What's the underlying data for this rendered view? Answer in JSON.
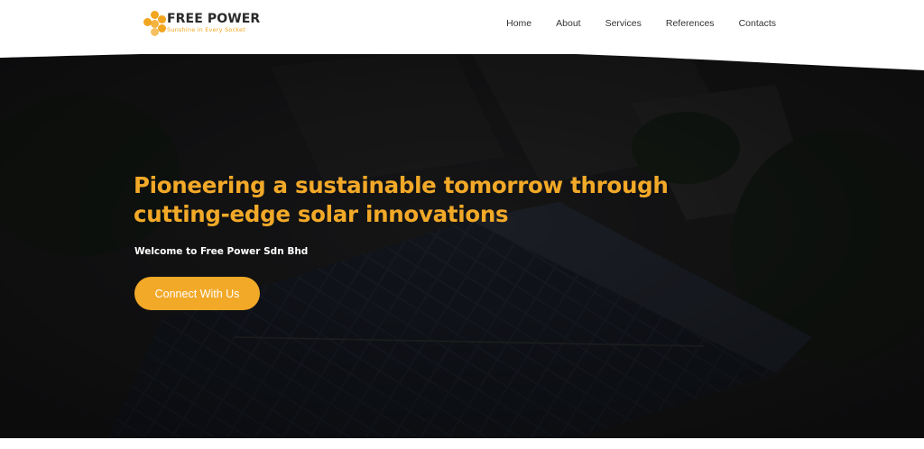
{
  "brand": {
    "name": "FREE POWER",
    "tagline": "Sunshine in Every Socket",
    "logo_icon": "honeycomb-dots-logo",
    "accent_color": "#f2a928"
  },
  "nav": {
    "items": [
      {
        "label": "Home"
      },
      {
        "label": "About"
      },
      {
        "label": "Services"
      },
      {
        "label": "References"
      },
      {
        "label": "Contacts"
      }
    ]
  },
  "hero": {
    "title": "Pioneering a sustainable tomorrow through cutting-edge solar innovations",
    "subtitle": "Welcome to Free Power Sdn Bhd",
    "cta_label": "Connect With Us",
    "background": "dark aerial photo of solar panels on rooftop"
  }
}
